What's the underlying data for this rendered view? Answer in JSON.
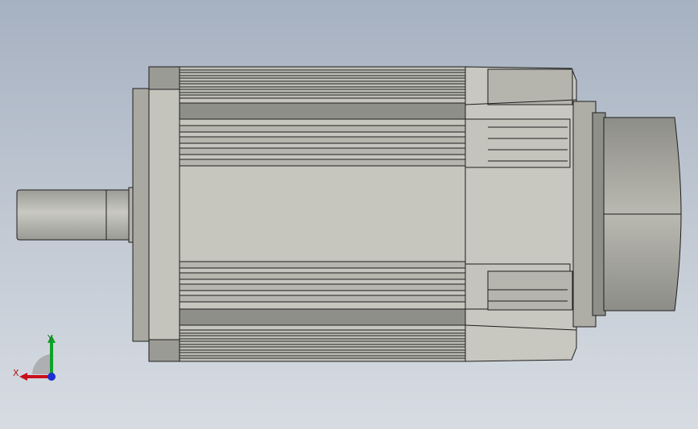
{
  "viewport": {
    "background_top": "#a6b1c1",
    "background_bottom": "#d7dce3"
  },
  "model": {
    "body_color": "#c4c4bc",
    "shade_color": "#8f8f89",
    "edge_color": "#1e1e1e"
  },
  "triad": {
    "x_label": "X",
    "y_label": "Y",
    "x_color": "#c8101a",
    "y_color": "#12a02a",
    "z_color": "#1c2fd0"
  }
}
